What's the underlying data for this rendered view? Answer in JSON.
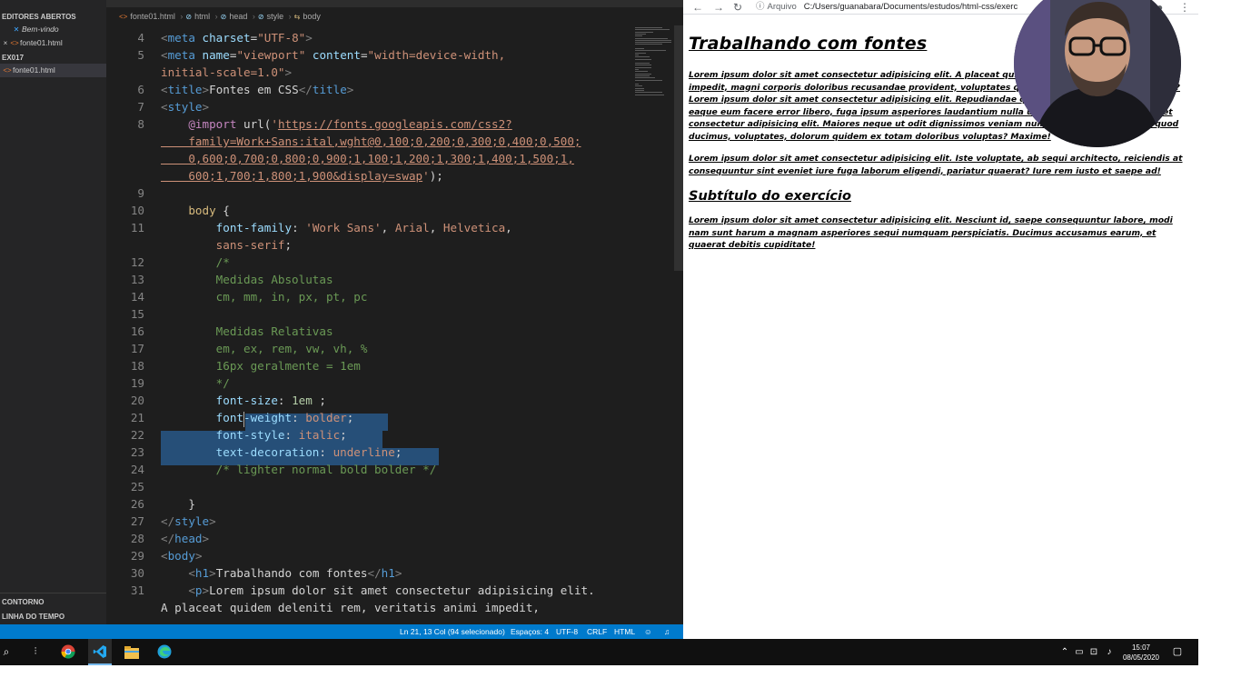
{
  "vscode": {
    "explorer": {
      "section_open_editors": "EDITORES ABERTOS",
      "open_editors": [
        {
          "label": "Bem-vindo",
          "icon": "vscode-icon"
        },
        {
          "label": "fonte01.html",
          "icon": "html-icon"
        }
      ],
      "section_folder": "EX017",
      "folder_files": [
        {
          "label": "fonte01.html",
          "icon": "html-icon"
        }
      ],
      "section_outline": "CONTORNO",
      "section_timeline": "LINHA DO TEMPO"
    },
    "breadcrumb": [
      "fonte01.html",
      "html",
      "head",
      "style",
      "body"
    ],
    "code_lines": [
      {
        "n": "4",
        "segs": [
          [
            "t-br",
            "<"
          ],
          [
            "t-tag",
            "meta "
          ],
          [
            "t-attr",
            "charset"
          ],
          [
            "t-txt",
            "="
          ],
          [
            "t-str",
            "\"UTF-8\""
          ],
          [
            "t-br",
            ">"
          ]
        ]
      },
      {
        "n": "5",
        "segs": [
          [
            "t-br",
            "<"
          ],
          [
            "t-tag",
            "meta "
          ],
          [
            "t-attr",
            "name"
          ],
          [
            "t-txt",
            "="
          ],
          [
            "t-str",
            "\"viewport\" "
          ],
          [
            "t-attr",
            "content"
          ],
          [
            "t-txt",
            "="
          ],
          [
            "t-str",
            "\"width=device-width,"
          ]
        ]
      },
      {
        "n": "",
        "segs": [
          [
            "t-str",
            "initial-scale=1.0\""
          ],
          [
            "t-br",
            ">"
          ]
        ]
      },
      {
        "n": "6",
        "segs": [
          [
            "t-br",
            "<"
          ],
          [
            "t-tag",
            "title"
          ],
          [
            "t-br",
            ">"
          ],
          [
            "t-txt",
            "Fontes em CSS"
          ],
          [
            "t-br",
            "</"
          ],
          [
            "t-tag",
            "title"
          ],
          [
            "t-br",
            ">"
          ]
        ]
      },
      {
        "n": "7",
        "segs": [
          [
            "t-br",
            "<"
          ],
          [
            "t-tag",
            "style"
          ],
          [
            "t-br",
            ">"
          ]
        ]
      },
      {
        "n": "8",
        "segs": [
          [
            "t-kw",
            "    @import "
          ],
          [
            "t-txt",
            "url("
          ],
          [
            "t-str",
            "'"
          ],
          [
            "t-url",
            "https://fonts.googleapis.com/css2?"
          ]
        ]
      },
      {
        "n": "",
        "segs": [
          [
            "t-url",
            "    family=Work+Sans:ital,wght@0,100;0,200;0,300;0,400;0,500;"
          ]
        ]
      },
      {
        "n": "",
        "segs": [
          [
            "t-url",
            "    0,600;0,700;0,800;0,900;1,100;1,200;1,300;1,400;1,500;1,"
          ]
        ]
      },
      {
        "n": "",
        "segs": [
          [
            "t-url",
            "    600;1,700;1,800;1,900&display=swap"
          ],
          [
            "t-str",
            "'"
          ],
          [
            "t-txt",
            ");"
          ]
        ]
      },
      {
        "n": "9",
        "segs": []
      },
      {
        "n": "10",
        "segs": [
          [
            "t-sel",
            "    body "
          ],
          [
            "t-txt",
            "{"
          ]
        ]
      },
      {
        "n": "11",
        "segs": [
          [
            "t-prop",
            "        font-family"
          ],
          [
            "t-txt",
            ": "
          ],
          [
            "t-val",
            "'Work Sans'"
          ],
          [
            "t-txt",
            ", "
          ],
          [
            "t-val",
            "Arial"
          ],
          [
            "t-txt",
            ", "
          ],
          [
            "t-val",
            "Helvetica"
          ],
          [
            "t-txt",
            ","
          ]
        ]
      },
      {
        "n": "",
        "segs": [
          [
            "t-val",
            "        sans-serif"
          ],
          [
            "t-txt",
            ";"
          ]
        ]
      },
      {
        "n": "12",
        "segs": [
          [
            "t-com",
            "        /*"
          ]
        ]
      },
      {
        "n": "13",
        "segs": [
          [
            "t-com",
            "        Medidas Absolutas"
          ]
        ]
      },
      {
        "n": "14",
        "segs": [
          [
            "t-com",
            "        cm, mm, in, px, pt, pc"
          ]
        ]
      },
      {
        "n": "15",
        "segs": []
      },
      {
        "n": "16",
        "segs": [
          [
            "t-com",
            "        Medidas Relativas"
          ]
        ]
      },
      {
        "n": "17",
        "segs": [
          [
            "t-com",
            "        em, ex, rem, vw, vh, %"
          ]
        ]
      },
      {
        "n": "18",
        "segs": [
          [
            "t-com",
            "        16px geralmente = 1em"
          ]
        ]
      },
      {
        "n": "19",
        "segs": [
          [
            "t-com",
            "        */"
          ]
        ]
      },
      {
        "n": "20",
        "segs": [
          [
            "t-prop",
            "        font-size"
          ],
          [
            "t-txt",
            ": "
          ],
          [
            "t-num",
            "1em"
          ],
          [
            "t-txt",
            " ;"
          ]
        ]
      },
      {
        "n": "21",
        "segs": [
          [
            "t-prop",
            "        font-weight"
          ],
          [
            "t-txt",
            ": "
          ],
          [
            "t-val",
            "bolder"
          ],
          [
            "t-txt",
            ";"
          ]
        ]
      },
      {
        "n": "22",
        "segs": [
          [
            "t-prop",
            "        font-style"
          ],
          [
            "t-txt",
            ": "
          ],
          [
            "t-val",
            "italic"
          ],
          [
            "t-txt",
            ";"
          ]
        ]
      },
      {
        "n": "23",
        "segs": [
          [
            "t-prop",
            "        text-decoration"
          ],
          [
            "t-txt",
            ": "
          ],
          [
            "t-val",
            "underline"
          ],
          [
            "t-txt",
            ";"
          ]
        ]
      },
      {
        "n": "24",
        "segs": [
          [
            "t-com",
            "        /* lighter normal bold bolder */"
          ]
        ]
      },
      {
        "n": "25",
        "segs": []
      },
      {
        "n": "26",
        "segs": [
          [
            "t-txt",
            "    }"
          ]
        ]
      },
      {
        "n": "27",
        "segs": [
          [
            "t-br",
            "</"
          ],
          [
            "t-tag",
            "style"
          ],
          [
            "t-br",
            ">"
          ]
        ]
      },
      {
        "n": "28",
        "segs": [
          [
            "t-br",
            "</"
          ],
          [
            "t-tag",
            "head"
          ],
          [
            "t-br",
            ">"
          ]
        ]
      },
      {
        "n": "29",
        "segs": [
          [
            "t-br",
            "<"
          ],
          [
            "t-tag",
            "body"
          ],
          [
            "t-br",
            ">"
          ]
        ]
      },
      {
        "n": "30",
        "segs": [
          [
            "t-br",
            "    <"
          ],
          [
            "t-tag",
            "h1"
          ],
          [
            "t-br",
            ">"
          ],
          [
            "t-txt",
            "Trabalhando com fontes"
          ],
          [
            "t-br",
            "</"
          ],
          [
            "t-tag",
            "h1"
          ],
          [
            "t-br",
            ">"
          ]
        ]
      },
      {
        "n": "31",
        "segs": [
          [
            "t-br",
            "    <"
          ],
          [
            "t-tag",
            "p"
          ],
          [
            "t-br",
            ">"
          ],
          [
            "t-txt",
            "Lorem ipsum dolor sit amet consectetur adipisicing elit."
          ]
        ]
      },
      {
        "n": "",
        "segs": [
          [
            "t-txt",
            "A placeat quidem deleniti rem, veritatis animi impedit,"
          ]
        ]
      }
    ],
    "status": {
      "position": "Ln 21, 13 Col (94 selecionado)",
      "spaces": "Espaços: 4",
      "encoding": "UTF-8",
      "eol": "CRLF",
      "language": "HTML"
    }
  },
  "browser": {
    "scheme_label": "Arquivo",
    "url": "C:/Users/guanabara/Documents/estudos/html-css/exerc",
    "h1": "Trabalhando com fontes",
    "p1": "Lorem ipsum dolor sit amet consectetur adipisicing elit. A placeat quidem deleniti rem, veritatis animi impedit, magni corporis doloribus recusandae provident, voluptates quae molestiae ut inventore. Fuga? Lorem ipsum dolor sit amet consectetur adipisicing elit. Repudiandae quo minus, nesciunt nobis sint eaque eum facere error libero, fuga ipsum asperiores laudantium nulla ut. Lorem ipsum dolor sit amet consectetur adipisicing elit. Maiores neque ut odit dignissimos veniam numquam molestiae omnis quod ducimus, voluptates, dolorum quidem ex totam doloribus voluptas? Maxime!",
    "p2": "Lorem ipsum dolor sit amet consectetur adipisicing elit. Iste voluptate, ab sequi architecto, reiciendis at consequuntur sint eveniet iure fuga laborum eligendi, pariatur quaerat? Iure rem iusto et saepe ad!",
    "h2": "Subtítulo do exercício",
    "p3": "Lorem ipsum dolor sit amet consectetur adipisicing elit. Nesciunt id, saepe consequuntur labore, modi nam sunt harum a magnam asperiores sequi numquam perspiciatis. Ducimus accusamus earum, et quaerat debitis cupiditate!"
  },
  "taskbar": {
    "time": "15:07",
    "date": "08/05/2020"
  },
  "colors": {
    "editor_bg": "#1e1e1e",
    "sidebar_bg": "#252526",
    "statusbar_bg": "#007acc",
    "selection": "#264f78",
    "taskbar_bg": "#101010"
  }
}
